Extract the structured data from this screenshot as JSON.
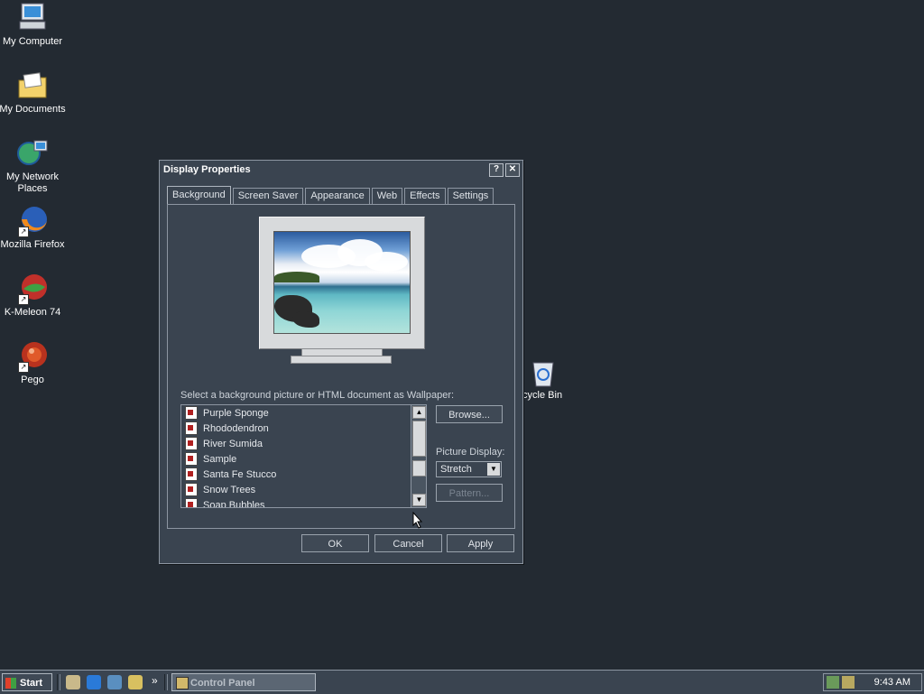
{
  "desktop": {
    "icons": [
      {
        "label": "My Computer",
        "icon": "computer-icon"
      },
      {
        "label": "My Documents",
        "icon": "documents-folder-icon"
      },
      {
        "label": "My Network Places",
        "icon": "network-places-icon"
      },
      {
        "label": "Mozilla Firefox",
        "icon": "firefox-icon"
      },
      {
        "label": "K-Meleon 74",
        "icon": "kmeleon-icon"
      },
      {
        "label": "Pego",
        "icon": "pego-icon"
      }
    ],
    "recycle_bin": {
      "label": "ecycle Bin",
      "icon": "recycle-bin-icon"
    }
  },
  "dialog": {
    "title": "Display Properties",
    "help_button": "?",
    "close_button": "✕",
    "tabs": [
      {
        "label": "Background",
        "active": true
      },
      {
        "label": "Screen Saver",
        "active": false
      },
      {
        "label": "Appearance",
        "active": false
      },
      {
        "label": "Web",
        "active": false
      },
      {
        "label": "Effects",
        "active": false
      },
      {
        "label": "Settings",
        "active": false
      }
    ],
    "wallpaper_label": "Select a background picture or HTML document as Wallpaper:",
    "wallpaper_list": [
      "Purple Sponge",
      "Rhododendron",
      "River Sumida",
      "Sample",
      "Santa Fe Stucco",
      "Snow Trees",
      "Soap Bubbles"
    ],
    "browse_button": "Browse...",
    "picture_display_label": "Picture Display:",
    "picture_display_value": "Stretch",
    "pattern_button": "Pattern...",
    "ok_button": "OK",
    "cancel_button": "Cancel",
    "apply_button": "Apply"
  },
  "taskbar": {
    "start_label": "Start",
    "quicklaunch_more": "»",
    "task_button": "Control Panel",
    "clock": "9:43 AM"
  }
}
